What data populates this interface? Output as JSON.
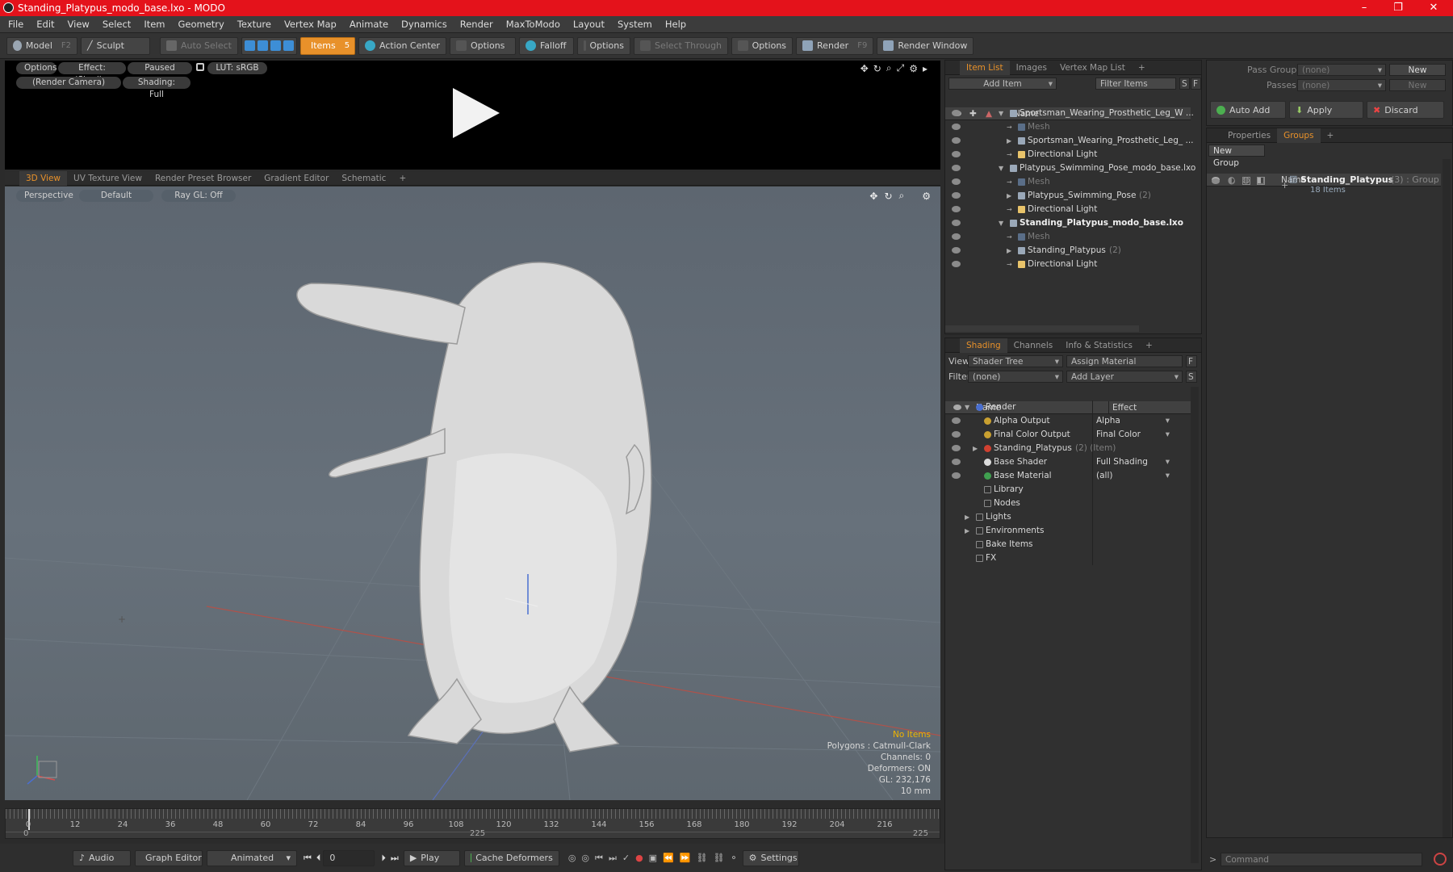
{
  "window": {
    "title": "Standing_Platypus_modo_base.lxo - MODO",
    "controls": [
      "–",
      "❐",
      "✕"
    ]
  },
  "menu": [
    "File",
    "Edit",
    "View",
    "Select",
    "Item",
    "Geometry",
    "Texture",
    "Vertex Map",
    "Animate",
    "Dynamics",
    "Render",
    "MaxToModo",
    "Layout",
    "System",
    "Help"
  ],
  "toolbar": {
    "model": "Model",
    "model_key": "F2",
    "sculpt": "Sculpt",
    "auto_select": "Auto Select",
    "items": "Items",
    "items_key": "5",
    "action_center": "Action Center",
    "options1": "Options",
    "falloff": "Falloff",
    "options2": "Options",
    "select_through": "Select Through",
    "options3": "Options",
    "render": "Render",
    "render_key": "F9",
    "render_window": "Render Window"
  },
  "render_view": {
    "options": "Options",
    "effect": "Effect: (Shadi...",
    "paused": "Paused",
    "lut": "LUT: sRGB",
    "camera": "(Render Camera)",
    "shading": "Shading: Full"
  },
  "view_tabs": [
    "3D View",
    "UV Texture View",
    "Render Preset Browser",
    "Gradient Editor",
    "Schematic",
    "+"
  ],
  "viewport": {
    "projection": "Perspective",
    "style": "Default",
    "raygl": "Ray GL: Off",
    "info_items": "No Items",
    "info_polygons": "Polygons : Catmull-Clark",
    "info_channels": "Channels: 0",
    "info_deformers": "Deformers: ON",
    "info_gl": "GL: 232,176",
    "info_scale": "10 mm"
  },
  "timeline": {
    "ticks": [
      "0",
      "12",
      "24",
      "36",
      "48",
      "60",
      "72",
      "84",
      "96",
      "108",
      "120",
      "132",
      "144",
      "156",
      "168",
      "180",
      "192",
      "204",
      "216"
    ],
    "start": "0",
    "mid": "225",
    "end": "225"
  },
  "bottombar": {
    "audio": "Audio",
    "graph_editor": "Graph Editor",
    "animated": "Animated",
    "frame": "0",
    "play": "Play",
    "cache": "Cache Deformers",
    "settings": "Settings"
  },
  "itemlist": {
    "tabs": [
      "Item List",
      "Images",
      "Vertex Map List",
      "+"
    ],
    "add_item": "Add Item",
    "filter": "Filter Items",
    "s": "S",
    "f": "F",
    "col_name": "Name",
    "rows": [
      {
        "label": "Sportsman_Wearing_Prosthetic_Leg_W ...",
        "indent": 0,
        "arrow": "▼",
        "kind": "scene"
      },
      {
        "label": "Mesh",
        "indent": 1,
        "arrow": "",
        "kind": "mesh"
      },
      {
        "label": "Sportsman_Wearing_Prosthetic_Leg_ ...",
        "indent": 1,
        "arrow": "▶",
        "kind": "group"
      },
      {
        "label": "Directional Light",
        "indent": 1,
        "arrow": "",
        "kind": "light"
      },
      {
        "label": "Platypus_Swimming_Pose_modo_base.lxo",
        "indent": 0,
        "arrow": "▼",
        "kind": "scene"
      },
      {
        "label": "Mesh",
        "indent": 1,
        "arrow": "",
        "kind": "mesh"
      },
      {
        "label": "Platypus_Swimming_Pose",
        "count": "(2)",
        "indent": 1,
        "arrow": "▶",
        "kind": "group"
      },
      {
        "label": "Directional Light",
        "indent": 1,
        "arrow": "",
        "kind": "light"
      },
      {
        "label": "Standing_Platypus_modo_base.lxo",
        "indent": 0,
        "arrow": "▼",
        "kind": "scene",
        "bold": true
      },
      {
        "label": "Mesh",
        "indent": 1,
        "arrow": "",
        "kind": "mesh"
      },
      {
        "label": "Standing_Platypus",
        "count": "(2)",
        "indent": 1,
        "arrow": "▶",
        "kind": "group"
      },
      {
        "label": "Directional Light",
        "indent": 1,
        "arrow": "",
        "kind": "light"
      }
    ]
  },
  "shading": {
    "tabs": [
      "Shading",
      "Channels",
      "Info & Statistics",
      "+"
    ],
    "view_label": "View",
    "view_value": "Shader Tree",
    "assign": "Assign Material",
    "filter_label": "Filter",
    "filter_value": "(none)",
    "add_layer": "Add Layer",
    "f": "F",
    "s": "S",
    "col_name": "Name",
    "col_effect": "Effect",
    "rows": [
      {
        "label": "Render",
        "effect": "",
        "indent": 0,
        "arrow": "▼",
        "eye": false,
        "icon": "#4a6fd0"
      },
      {
        "label": "Alpha Output",
        "effect": "Alpha",
        "indent": 1,
        "arrow": "",
        "eye": true,
        "icon": "#c9a030"
      },
      {
        "label": "Final Color Output",
        "effect": "Final Color",
        "indent": 1,
        "arrow": "",
        "eye": true,
        "icon": "#c9a030"
      },
      {
        "label": "Standing_Platypus",
        "count": "(2) (Item)",
        "effect": "",
        "indent": 1,
        "arrow": "▶",
        "eye": true,
        "icon": "#d04030"
      },
      {
        "label": "Base Shader",
        "effect": "Full Shading",
        "indent": 1,
        "arrow": "",
        "eye": true,
        "icon": "#dcdcdc"
      },
      {
        "label": "Base Material",
        "effect": "(all)",
        "indent": 1,
        "arrow": "",
        "eye": true,
        "icon": "#40a050"
      },
      {
        "label": "Library",
        "effect": "",
        "indent": 1,
        "arrow": "",
        "eye": false,
        "icon": ""
      },
      {
        "label": "Nodes",
        "effect": "",
        "indent": 1,
        "arrow": "",
        "eye": false,
        "icon": ""
      },
      {
        "label": "Lights",
        "effect": "",
        "indent": 0,
        "arrow": "▶",
        "eye": false,
        "icon": ""
      },
      {
        "label": "Environments",
        "effect": "",
        "indent": 0,
        "arrow": "▶",
        "eye": false,
        "icon": ""
      },
      {
        "label": "Bake Items",
        "effect": "",
        "indent": 0,
        "arrow": "",
        "eye": false,
        "icon": ""
      },
      {
        "label": "FX",
        "effect": "",
        "indent": 0,
        "arrow": "",
        "eye": false,
        "icon": ""
      }
    ]
  },
  "right": {
    "pass_groups": "Pass Groups",
    "pass_value": "(none)",
    "new": "New",
    "passes": "Passes",
    "passes_value": "(none)",
    "new2": "New",
    "auto_add": "Auto Add",
    "apply": "Apply",
    "discard": "Discard",
    "tabs": [
      "Properties",
      "Groups",
      "+"
    ],
    "new_group": "New Group",
    "col_name": "Name",
    "group_name": "Standing_Platypus",
    "group_count": "(3) : Group",
    "group_items": "18 Items",
    "command": "Command"
  }
}
